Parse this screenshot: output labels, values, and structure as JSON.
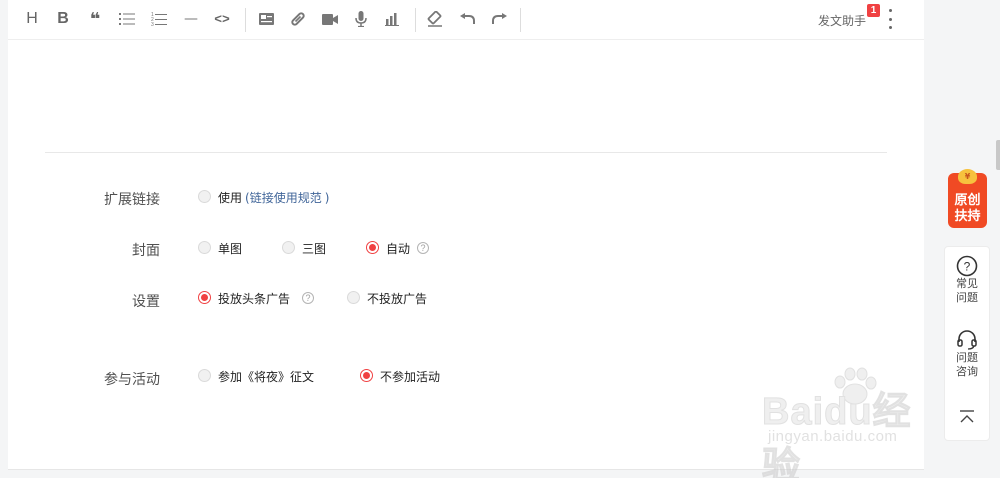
{
  "toolbar": {
    "buttons": [
      {
        "name": "heading-icon",
        "glyph": "H"
      },
      {
        "name": "bold-icon",
        "glyph": "B"
      },
      {
        "name": "quote-icon",
        "glyph": "❝"
      },
      {
        "name": "unordered-list-icon",
        "glyph": ""
      },
      {
        "name": "ordered-list-icon",
        "glyph": ""
      },
      {
        "name": "horizontal-rule-icon",
        "glyph": "—"
      },
      {
        "name": "code-icon",
        "glyph": "<>"
      },
      {
        "name": "image-icon",
        "glyph": ""
      },
      {
        "name": "link-icon",
        "glyph": ""
      },
      {
        "name": "video-icon",
        "glyph": ""
      },
      {
        "name": "audio-icon",
        "glyph": ""
      },
      {
        "name": "chart-icon",
        "glyph": ""
      },
      {
        "name": "eraser-icon",
        "glyph": ""
      },
      {
        "name": "undo-icon",
        "glyph": ""
      },
      {
        "name": "redo-icon",
        "glyph": ""
      }
    ],
    "assistant_label": "发文助手",
    "assistant_badge": "1"
  },
  "settings": {
    "extended_link": {
      "label": "扩展链接",
      "option_text": "使用",
      "paren_open": "(",
      "link_text": "链接使用规范",
      "paren_close": ")"
    },
    "cover": {
      "label": "封面",
      "options": [
        "单图",
        "三图",
        "自动"
      ],
      "selected": "自动",
      "help": "?"
    },
    "ads": {
      "label": "设置",
      "options": [
        "投放头条广告",
        "不投放广告"
      ],
      "selected": "投放头条广告",
      "help": "?"
    },
    "activity": {
      "label": "参与活动",
      "options": [
        "参加《将夜》征文",
        "不参加活动"
      ],
      "selected": "不参加活动"
    }
  },
  "side": {
    "promo_line1": "原创",
    "promo_line2": "扶持",
    "promo_coin": "¥",
    "faq_line1": "常见",
    "faq_line2": "问题",
    "consult_line1": "问题",
    "consult_line2": "咨询",
    "faq_icon": "?"
  },
  "watermark": {
    "main": "Baidu经验",
    "sub": "jingyan.baidu.com"
  },
  "colors": {
    "accent": "#f04142",
    "link": "#406599",
    "promo": "#f04a24"
  }
}
